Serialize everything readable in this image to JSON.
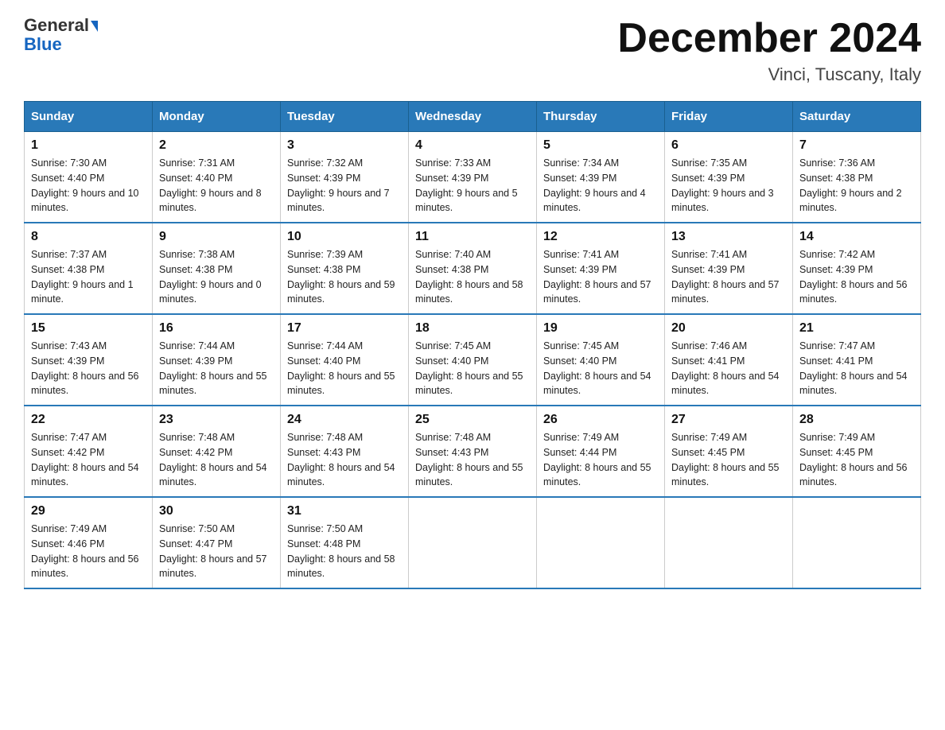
{
  "logo": {
    "general": "General",
    "blue": "Blue"
  },
  "title": "December 2024",
  "subtitle": "Vinci, Tuscany, Italy",
  "days_of_week": [
    "Sunday",
    "Monday",
    "Tuesday",
    "Wednesday",
    "Thursday",
    "Friday",
    "Saturday"
  ],
  "weeks": [
    [
      {
        "day": "1",
        "sunrise": "Sunrise: 7:30 AM",
        "sunset": "Sunset: 4:40 PM",
        "daylight": "Daylight: 9 hours and 10 minutes."
      },
      {
        "day": "2",
        "sunrise": "Sunrise: 7:31 AM",
        "sunset": "Sunset: 4:40 PM",
        "daylight": "Daylight: 9 hours and 8 minutes."
      },
      {
        "day": "3",
        "sunrise": "Sunrise: 7:32 AM",
        "sunset": "Sunset: 4:39 PM",
        "daylight": "Daylight: 9 hours and 7 minutes."
      },
      {
        "day": "4",
        "sunrise": "Sunrise: 7:33 AM",
        "sunset": "Sunset: 4:39 PM",
        "daylight": "Daylight: 9 hours and 5 minutes."
      },
      {
        "day": "5",
        "sunrise": "Sunrise: 7:34 AM",
        "sunset": "Sunset: 4:39 PM",
        "daylight": "Daylight: 9 hours and 4 minutes."
      },
      {
        "day": "6",
        "sunrise": "Sunrise: 7:35 AM",
        "sunset": "Sunset: 4:39 PM",
        "daylight": "Daylight: 9 hours and 3 minutes."
      },
      {
        "day": "7",
        "sunrise": "Sunrise: 7:36 AM",
        "sunset": "Sunset: 4:38 PM",
        "daylight": "Daylight: 9 hours and 2 minutes."
      }
    ],
    [
      {
        "day": "8",
        "sunrise": "Sunrise: 7:37 AM",
        "sunset": "Sunset: 4:38 PM",
        "daylight": "Daylight: 9 hours and 1 minute."
      },
      {
        "day": "9",
        "sunrise": "Sunrise: 7:38 AM",
        "sunset": "Sunset: 4:38 PM",
        "daylight": "Daylight: 9 hours and 0 minutes."
      },
      {
        "day": "10",
        "sunrise": "Sunrise: 7:39 AM",
        "sunset": "Sunset: 4:38 PM",
        "daylight": "Daylight: 8 hours and 59 minutes."
      },
      {
        "day": "11",
        "sunrise": "Sunrise: 7:40 AM",
        "sunset": "Sunset: 4:38 PM",
        "daylight": "Daylight: 8 hours and 58 minutes."
      },
      {
        "day": "12",
        "sunrise": "Sunrise: 7:41 AM",
        "sunset": "Sunset: 4:39 PM",
        "daylight": "Daylight: 8 hours and 57 minutes."
      },
      {
        "day": "13",
        "sunrise": "Sunrise: 7:41 AM",
        "sunset": "Sunset: 4:39 PM",
        "daylight": "Daylight: 8 hours and 57 minutes."
      },
      {
        "day": "14",
        "sunrise": "Sunrise: 7:42 AM",
        "sunset": "Sunset: 4:39 PM",
        "daylight": "Daylight: 8 hours and 56 minutes."
      }
    ],
    [
      {
        "day": "15",
        "sunrise": "Sunrise: 7:43 AM",
        "sunset": "Sunset: 4:39 PM",
        "daylight": "Daylight: 8 hours and 56 minutes."
      },
      {
        "day": "16",
        "sunrise": "Sunrise: 7:44 AM",
        "sunset": "Sunset: 4:39 PM",
        "daylight": "Daylight: 8 hours and 55 minutes."
      },
      {
        "day": "17",
        "sunrise": "Sunrise: 7:44 AM",
        "sunset": "Sunset: 4:40 PM",
        "daylight": "Daylight: 8 hours and 55 minutes."
      },
      {
        "day": "18",
        "sunrise": "Sunrise: 7:45 AM",
        "sunset": "Sunset: 4:40 PM",
        "daylight": "Daylight: 8 hours and 55 minutes."
      },
      {
        "day": "19",
        "sunrise": "Sunrise: 7:45 AM",
        "sunset": "Sunset: 4:40 PM",
        "daylight": "Daylight: 8 hours and 54 minutes."
      },
      {
        "day": "20",
        "sunrise": "Sunrise: 7:46 AM",
        "sunset": "Sunset: 4:41 PM",
        "daylight": "Daylight: 8 hours and 54 minutes."
      },
      {
        "day": "21",
        "sunrise": "Sunrise: 7:47 AM",
        "sunset": "Sunset: 4:41 PM",
        "daylight": "Daylight: 8 hours and 54 minutes."
      }
    ],
    [
      {
        "day": "22",
        "sunrise": "Sunrise: 7:47 AM",
        "sunset": "Sunset: 4:42 PM",
        "daylight": "Daylight: 8 hours and 54 minutes."
      },
      {
        "day": "23",
        "sunrise": "Sunrise: 7:48 AM",
        "sunset": "Sunset: 4:42 PM",
        "daylight": "Daylight: 8 hours and 54 minutes."
      },
      {
        "day": "24",
        "sunrise": "Sunrise: 7:48 AM",
        "sunset": "Sunset: 4:43 PM",
        "daylight": "Daylight: 8 hours and 54 minutes."
      },
      {
        "day": "25",
        "sunrise": "Sunrise: 7:48 AM",
        "sunset": "Sunset: 4:43 PM",
        "daylight": "Daylight: 8 hours and 55 minutes."
      },
      {
        "day": "26",
        "sunrise": "Sunrise: 7:49 AM",
        "sunset": "Sunset: 4:44 PM",
        "daylight": "Daylight: 8 hours and 55 minutes."
      },
      {
        "day": "27",
        "sunrise": "Sunrise: 7:49 AM",
        "sunset": "Sunset: 4:45 PM",
        "daylight": "Daylight: 8 hours and 55 minutes."
      },
      {
        "day": "28",
        "sunrise": "Sunrise: 7:49 AM",
        "sunset": "Sunset: 4:45 PM",
        "daylight": "Daylight: 8 hours and 56 minutes."
      }
    ],
    [
      {
        "day": "29",
        "sunrise": "Sunrise: 7:49 AM",
        "sunset": "Sunset: 4:46 PM",
        "daylight": "Daylight: 8 hours and 56 minutes."
      },
      {
        "day": "30",
        "sunrise": "Sunrise: 7:50 AM",
        "sunset": "Sunset: 4:47 PM",
        "daylight": "Daylight: 8 hours and 57 minutes."
      },
      {
        "day": "31",
        "sunrise": "Sunrise: 7:50 AM",
        "sunset": "Sunset: 4:48 PM",
        "daylight": "Daylight: 8 hours and 58 minutes."
      },
      null,
      null,
      null,
      null
    ]
  ]
}
